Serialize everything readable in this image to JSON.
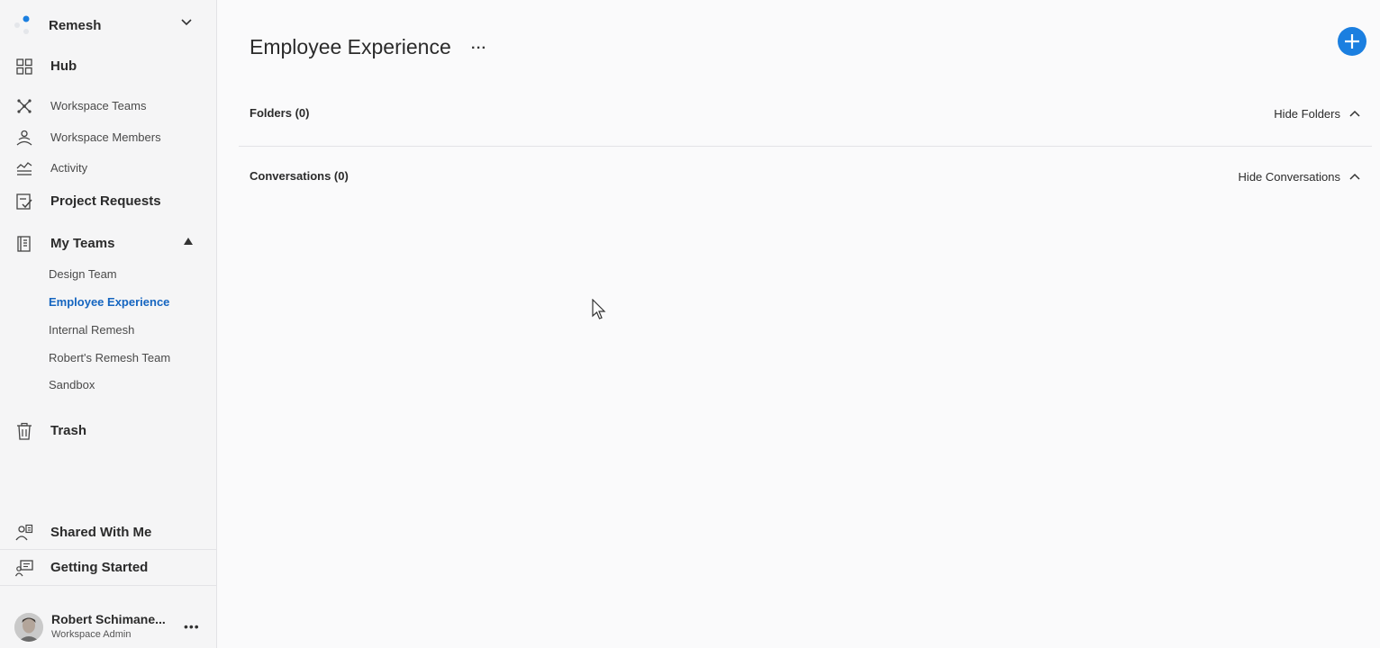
{
  "workspace": {
    "name": "Remesh",
    "brand_color": "#1b7fe0"
  },
  "nav": {
    "hub": "Hub",
    "workspace_teams": "Workspace Teams",
    "workspace_members": "Workspace Members",
    "activity": "Activity",
    "project_requests": "Project Requests",
    "my_teams": "My Teams",
    "trash": "Trash",
    "shared_with_me": "Shared With Me",
    "getting_started": "Getting Started"
  },
  "teams": [
    {
      "label": "Design Team",
      "active": false
    },
    {
      "label": "Employee Experience",
      "active": true
    },
    {
      "label": "Internal Remesh",
      "active": false
    },
    {
      "label": "Robert's Remesh Team",
      "active": false
    },
    {
      "label": "Sandbox",
      "active": false
    }
  ],
  "user": {
    "name": "Robert Schimane...",
    "role": "Workspace Admin"
  },
  "main": {
    "title": "Employee Experience",
    "more": "···",
    "folders_label": "Folders (0)",
    "hide_folders": "Hide Folders",
    "conversations_label": "Conversations (0)",
    "hide_conversations": "Hide Conversations"
  },
  "active_color": "#1565c0"
}
